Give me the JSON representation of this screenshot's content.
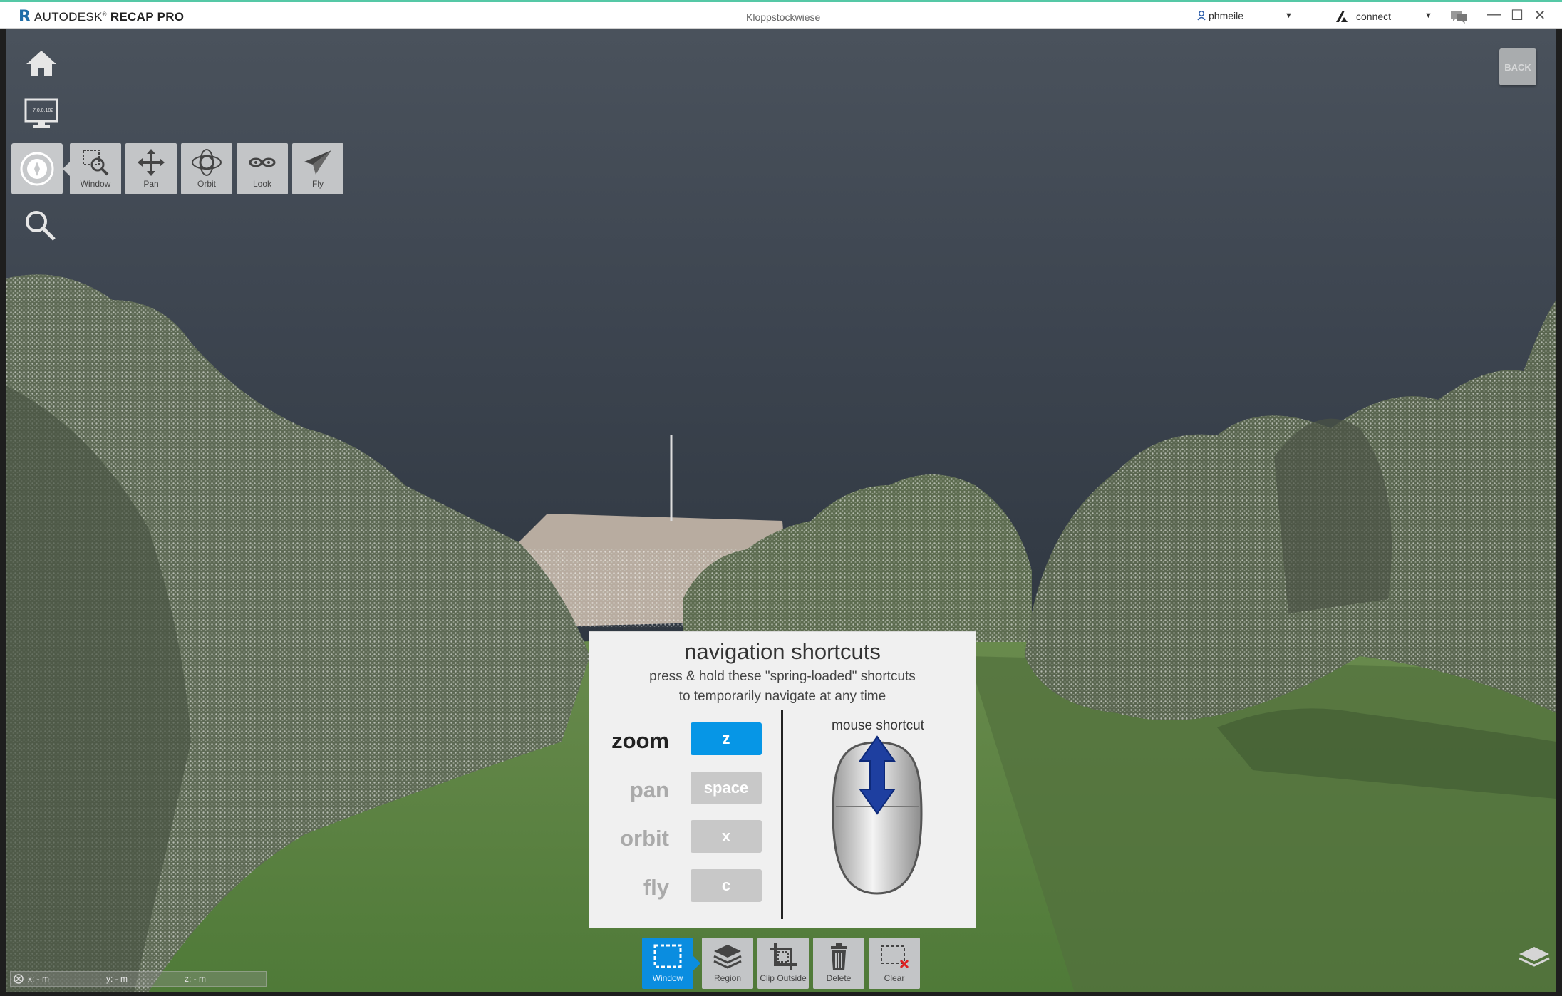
{
  "titlebar": {
    "logo_letter": "R",
    "brand": "AUTODESK",
    "product": "RECAP PRO",
    "document_title": "Kloppstockwiese",
    "user": "phmeile",
    "connect": "connect"
  },
  "toolbar": {
    "display_badge": "7.0.0.182",
    "nav_tools": [
      {
        "label": "Window",
        "icon": "window-zoom-icon"
      },
      {
        "label": "Pan",
        "icon": "pan-arrows-icon"
      },
      {
        "label": "Orbit",
        "icon": "orbit-icon"
      },
      {
        "label": "Look",
        "icon": "look-eyes-icon"
      },
      {
        "label": "Fly",
        "icon": "paper-plane-icon"
      }
    ],
    "back_label": "BACK"
  },
  "shortcuts_panel": {
    "title": "navigation shortcuts",
    "subtitle_line1": "press & hold these \"spring-loaded\" shortcuts",
    "subtitle_line2": "to temporarily navigate at any time",
    "rows": [
      {
        "name": "zoom",
        "key": "z",
        "active": true
      },
      {
        "name": "pan",
        "key": "space",
        "active": false
      },
      {
        "name": "orbit",
        "key": "x",
        "active": false
      },
      {
        "name": "fly",
        "key": "c",
        "active": false
      }
    ],
    "mouse_label": "mouse shortcut",
    "active_color": "#0696e6"
  },
  "selection_tools": [
    {
      "label": "Window",
      "icon": "window-select-icon",
      "active": true
    },
    {
      "label": "Region",
      "icon": "layers-region-icon",
      "active": false
    },
    {
      "label": "Clip Outside",
      "icon": "clip-crop-icon",
      "active": false
    },
    {
      "label": "Delete",
      "icon": "trash-icon",
      "active": false
    },
    {
      "label": "Clear",
      "icon": "clear-selection-icon",
      "active": false
    }
  ],
  "coordinates": {
    "x": "x: - m",
    "y": "y: - m",
    "z": "z: - m"
  }
}
